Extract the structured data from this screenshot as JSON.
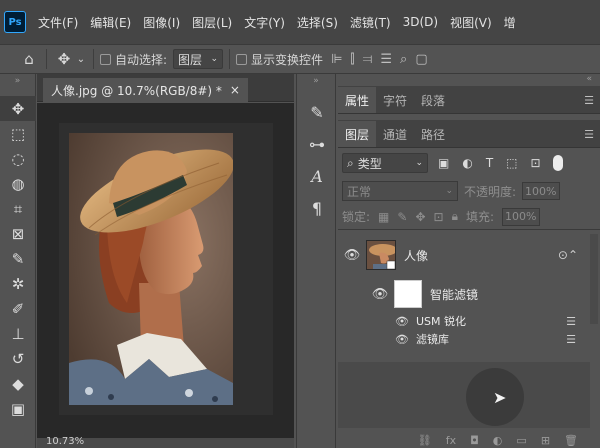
{
  "app": {
    "logo": "Ps"
  },
  "menu": [
    "文件(F)",
    "编辑(E)",
    "图像(I)",
    "图层(L)",
    "文字(Y)",
    "选择(S)",
    "滤镜(T)",
    "3D(D)",
    "视图(V)",
    "增"
  ],
  "options": {
    "home_icon": "home-icon",
    "move_icon": "move-icon",
    "auto_select_label": "自动选择:",
    "auto_select_value": "图层",
    "show_transform_label": "显示变换控件"
  },
  "document": {
    "tab_title": "人像.jpg @ 10.7%(RGB/8#) *",
    "close": "×",
    "zoom_status": "10.73%"
  },
  "panels": {
    "top_tabs": [
      "属性",
      "字符",
      "段落"
    ],
    "layer_tabs": [
      "图层",
      "通道",
      "路径"
    ],
    "filter_type": "类型",
    "blend_mode": "正常",
    "opacity_label": "不透明度:",
    "opacity_value": "100%",
    "lock_label": "锁定:",
    "fill_label": "填充:",
    "fill_value": "100%"
  },
  "layers": {
    "main_name": "人像",
    "smart_filter_label": "智能滤镜",
    "filters": [
      "USM 锐化",
      "滤镜库"
    ]
  },
  "colors": {
    "accent": "#31a8ff",
    "panel_bg": "#535353",
    "menubar_bg": "#454545"
  }
}
